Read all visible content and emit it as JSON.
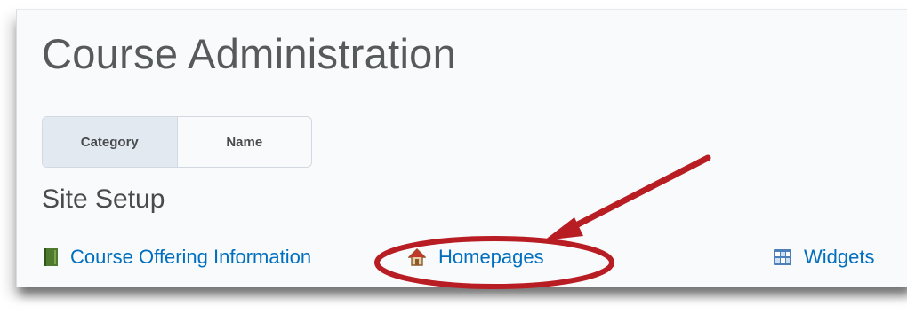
{
  "page": {
    "title": "Course Administration"
  },
  "view_toggle": {
    "options": [
      "Category",
      "Name"
    ],
    "selected": "Category"
  },
  "section": {
    "heading": "Site Setup",
    "tools": [
      {
        "label": "Course Offering Information",
        "icon": "book-icon"
      },
      {
        "label": "Homepages",
        "icon": "house-icon"
      },
      {
        "label": "Widgets",
        "icon": "widget-grid-icon"
      }
    ]
  },
  "colors": {
    "link": "#006fbf",
    "title_text": "#565a5c",
    "active_toggle": "#e3e9f1",
    "annotation": "#b81d24"
  }
}
